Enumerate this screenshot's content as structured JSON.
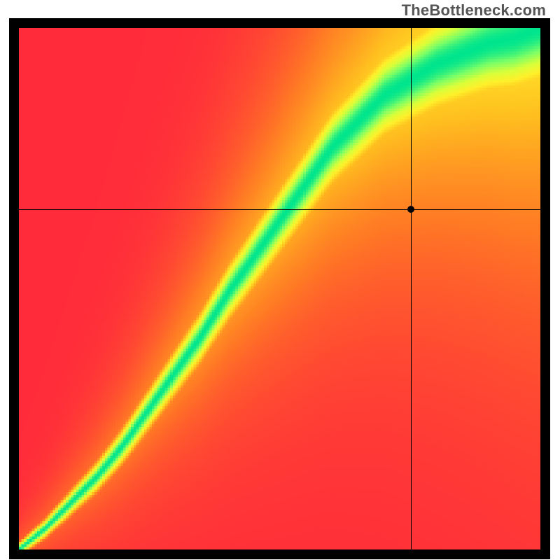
{
  "watermark": "TheBottleneck.com",
  "chart_data": {
    "type": "heatmap",
    "title": "",
    "xlabel": "",
    "ylabel": "",
    "xlim": [
      0,
      1
    ],
    "ylim": [
      0,
      1
    ],
    "grid": false,
    "legend": false,
    "color_scale": [
      "#ff2b3a",
      "#ff7a24",
      "#ffbf1f",
      "#fff02a",
      "#d7ff3a",
      "#7cff66",
      "#00e58d"
    ],
    "ridge": [
      {
        "x": 0.0,
        "y": 0.0
      },
      {
        "x": 0.05,
        "y": 0.04
      },
      {
        "x": 0.1,
        "y": 0.09
      },
      {
        "x": 0.15,
        "y": 0.14
      },
      {
        "x": 0.2,
        "y": 0.2
      },
      {
        "x": 0.25,
        "y": 0.27
      },
      {
        "x": 0.3,
        "y": 0.34
      },
      {
        "x": 0.35,
        "y": 0.41
      },
      {
        "x": 0.4,
        "y": 0.49
      },
      {
        "x": 0.45,
        "y": 0.56
      },
      {
        "x": 0.5,
        "y": 0.63
      },
      {
        "x": 0.55,
        "y": 0.7
      },
      {
        "x": 0.6,
        "y": 0.77
      },
      {
        "x": 0.65,
        "y": 0.82
      },
      {
        "x": 0.7,
        "y": 0.87
      },
      {
        "x": 0.75,
        "y": 0.9
      },
      {
        "x": 0.8,
        "y": 0.93
      },
      {
        "x": 0.85,
        "y": 0.95
      },
      {
        "x": 0.9,
        "y": 0.97
      },
      {
        "x": 0.95,
        "y": 0.98
      },
      {
        "x": 1.0,
        "y": 1.0
      }
    ],
    "ridge_width_base": 0.01,
    "ridge_width_gain": 0.085,
    "crosshair": {
      "x": 0.752,
      "y": 0.653
    },
    "marker": {
      "x": 0.752,
      "y": 0.653
    },
    "render_resolution": 200
  }
}
